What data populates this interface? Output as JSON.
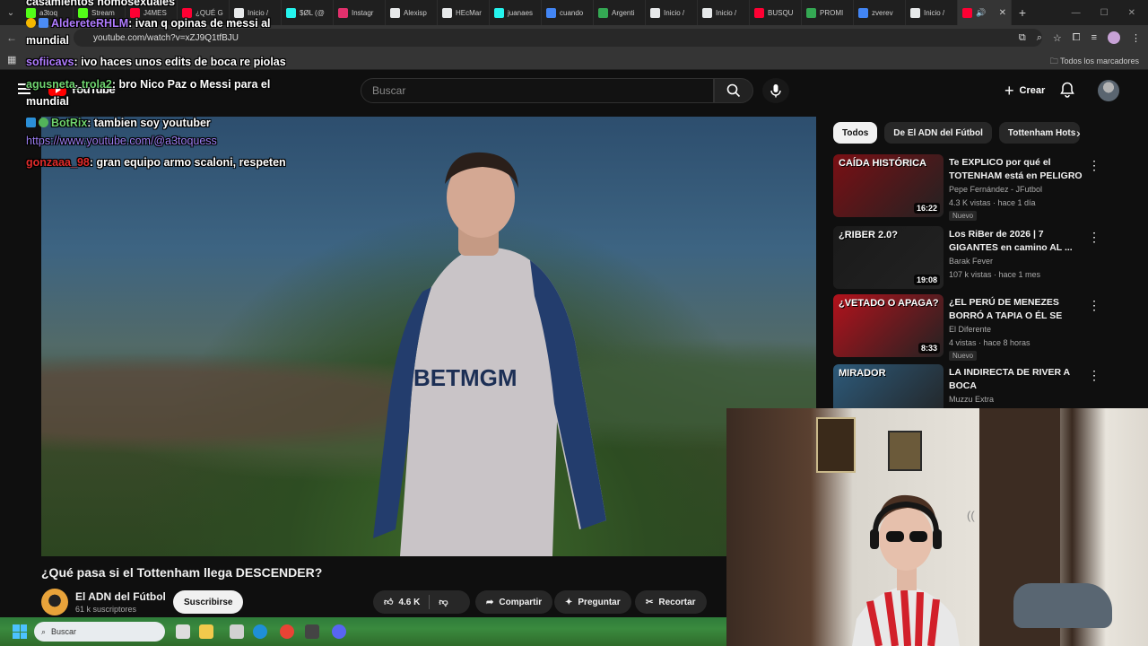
{
  "browser": {
    "tabs": [
      {
        "label": "a3toq",
        "color": "#53fc18"
      },
      {
        "label": "Stream",
        "color": "#53fc18"
      },
      {
        "label": "J4MES",
        "color": "#ff0033"
      },
      {
        "label": "¿QUÉ G",
        "color": "#ff0033"
      },
      {
        "label": "Inicio /",
        "color": "#e7e9ea"
      },
      {
        "label": "$ØL (@",
        "color": "#25f4ee"
      },
      {
        "label": "Instagr",
        "color": "#e1306c"
      },
      {
        "label": "Alexisp",
        "color": "#e7e9ea"
      },
      {
        "label": "HEcMar",
        "color": "#e7e9ea"
      },
      {
        "label": "juanaes",
        "color": "#25f4ee"
      },
      {
        "label": "cuando",
        "color": "#4285f4"
      },
      {
        "label": "Argenti",
        "color": "#34a853"
      },
      {
        "label": "Inicio /",
        "color": "#e7e9ea"
      },
      {
        "label": "Inicio /",
        "color": "#e7e9ea"
      },
      {
        "label": "BUSQU",
        "color": "#ff0033"
      },
      {
        "label": "PROMI",
        "color": "#34a853"
      },
      {
        "label": "zverev",
        "color": "#4285f4"
      },
      {
        "label": "Inicio /",
        "color": "#e7e9ea"
      }
    ],
    "url": "youtube.com/watch?v=xZJ9Q1tfBJU",
    "all_bookmarks": "Todos los marcadores"
  },
  "youtube": {
    "logo": "YouTube",
    "search_placeholder": "Buscar",
    "create_label": "Crear",
    "video_title": "¿Qué pasa si el Tottenham llega DESCENDER?",
    "channel_name": "El ADN del Fútbol",
    "channel_subs": "61 k suscriptores",
    "subscribe_label": "Suscribirse",
    "likes": "4.6 K",
    "share_label": "Compartir",
    "ask_label": "Preguntar",
    "clip_label": "Recortar",
    "jersey_text": "BETMGM",
    "chips": [
      "Todos",
      "De El ADN del Fútbol",
      "Tottenham Hots"
    ],
    "suggestions": [
      {
        "title": "Te EXPLICO por qué el TOTENHAM está en PELIGRO ...",
        "channel": "Pepe Fernández - JFutbol",
        "views": "4.3 K vistas · hace 1 día",
        "duration": "16:22",
        "badge": "Nuevo",
        "thumb_text": "CAÍDA HISTÓRICA",
        "thumb_color": "#7a0f14"
      },
      {
        "title": "Los RiBer de 2026 | 7 GIGANTES en camino AL ...",
        "channel": "Barak Fever",
        "views": "107 k vistas · hace 1 mes",
        "duration": "19:08",
        "badge": "",
        "thumb_text": "¿RIBER 2.0?",
        "thumb_color": "#1a1a1a"
      },
      {
        "title": "¿EL PERÚ DE MENEZES BORRÓ A TAPIA O ÉL SE BORRÓ SOLO?",
        "channel": "El Diferente",
        "views": "4 vistas · hace 8 horas",
        "duration": "8:33",
        "badge": "Nuevo",
        "thumb_text": "¿VETADO O APAGA?",
        "thumb_color": "#b3121c"
      },
      {
        "title": "LA INDIRECTA DE RIVER A BOCA",
        "channel": "Muzzu Extra",
        "views": "",
        "duration": "",
        "badge": "",
        "thumb_text": "MIRADOR",
        "thumb_color": "#2d5a7a"
      }
    ]
  },
  "chat": [
    {
      "user": "",
      "text": "casamientos homosexuales",
      "color": "#ffffff"
    },
    {
      "user": "AldereteRHLM",
      "text": ": ivan q opinas de messi al",
      "color": "#b07cff"
    },
    {
      "user": "",
      "text": "mundial",
      "color": "#ffffff"
    },
    {
      "user": "sofiicavs",
      "text": ": ivo haces unos edits de boca re piolas",
      "color": "#b07cff"
    },
    {
      "user": "agusneta_trola2",
      "text": ": bro Nico Paz o Messi para el",
      "color": "#6fd36f"
    },
    {
      "user": "",
      "text": "mundial",
      "color": "#ffffff"
    },
    {
      "user": "BotRix",
      "text": ": tambien soy youtuber",
      "color": "#6fd36f"
    },
    {
      "user": "",
      "text": "https://www.youtube.com/@a3toquess",
      "color": "#9b7df0"
    },
    {
      "user": "gonzaaa_98",
      "text": ": gran equipo armo scaloni, respeten",
      "color": "#e02b2b"
    }
  ],
  "taskbar": {
    "search_label": "Buscar"
  }
}
